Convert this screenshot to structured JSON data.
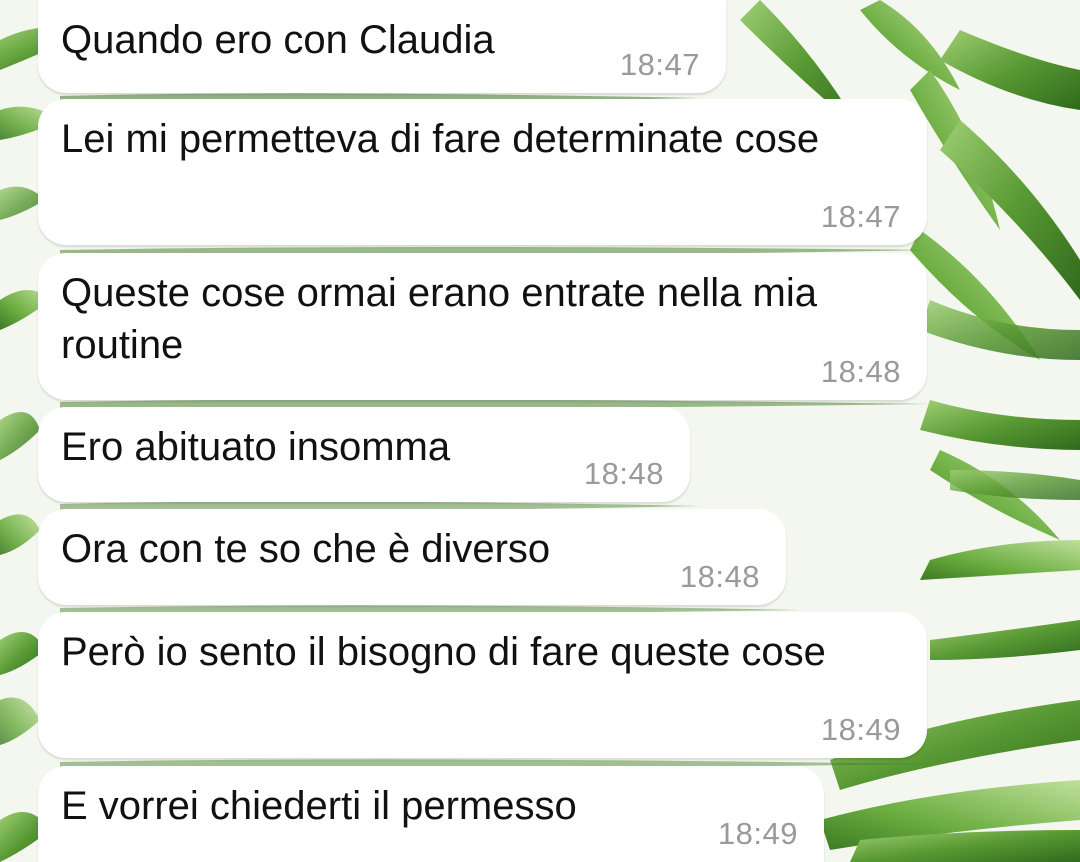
{
  "theme": {
    "bubble_color": "#ffffff",
    "text_color": "#111111",
    "time_color": "#9a9a9a",
    "wallpaper_leaf_color": "#5f9e3a"
  },
  "messages": [
    {
      "text": "Quando ero con Claudia",
      "time": "18:47"
    },
    {
      "text": "Lei mi permetteva di fare determinate cose",
      "time": "18:47"
    },
    {
      "text": "Queste cose ormai erano entrate nella mia routine",
      "time": "18:48"
    },
    {
      "text": "Ero abituato insomma",
      "time": "18:48"
    },
    {
      "text": "Ora con te so che è diverso",
      "time": "18:48"
    },
    {
      "text": "Però io sento il bisogno di fare queste cose",
      "time": "18:49"
    },
    {
      "text": "E vorrei chiederti il permesso",
      "time": "18:49"
    }
  ]
}
